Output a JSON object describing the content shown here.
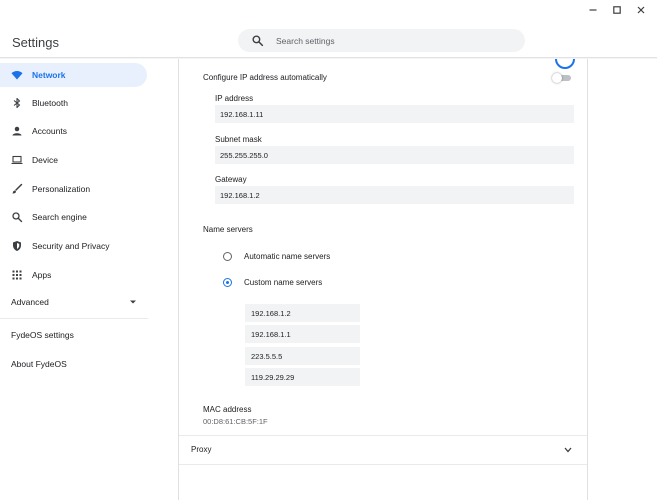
{
  "app": {
    "title": "Settings"
  },
  "search": {
    "placeholder": "Search settings"
  },
  "colors": {
    "accent": "#1a73e8",
    "active_bg": "#e8f0fe",
    "field_bg": "#f1f3f4"
  },
  "sidebar": {
    "items": [
      {
        "label": "Network",
        "icon": "wifi-icon",
        "active": true
      },
      {
        "label": "Bluetooth",
        "icon": "bluetooth-icon",
        "active": false
      },
      {
        "label": "Accounts",
        "icon": "person-icon",
        "active": false
      },
      {
        "label": "Device",
        "icon": "laptop-icon",
        "active": false
      },
      {
        "label": "Personalization",
        "icon": "brush-icon",
        "active": false
      },
      {
        "label": "Search engine",
        "icon": "search-icon",
        "active": false
      },
      {
        "label": "Security and Privacy",
        "icon": "shield-icon",
        "active": false
      },
      {
        "label": "Apps",
        "icon": "apps-grid-icon",
        "active": false
      }
    ],
    "advanced_label": "Advanced",
    "extra_items": [
      "FydeOS settings",
      "About FydeOS"
    ]
  },
  "network": {
    "configure_label": "Configure IP address automatically",
    "auto_configure": false,
    "ip_label": "IP address",
    "ip_value": "192.168.1.11",
    "subnet_label": "Subnet mask",
    "subnet_value": "255.255.255.0",
    "gateway_label": "Gateway",
    "gateway_value": "192.168.1.2",
    "name_servers_label": "Name servers",
    "auto_ns_label": "Automatic name servers",
    "custom_ns_label": "Custom name servers",
    "selected_ns_mode": "custom",
    "custom_servers": [
      "192.168.1.2",
      "192.168.1.1",
      "223.5.5.5",
      "119.29.29.29"
    ],
    "mac_label": "MAC address",
    "mac_value": "00:D8:61:CB:5F:1F",
    "proxy_label": "Proxy"
  }
}
